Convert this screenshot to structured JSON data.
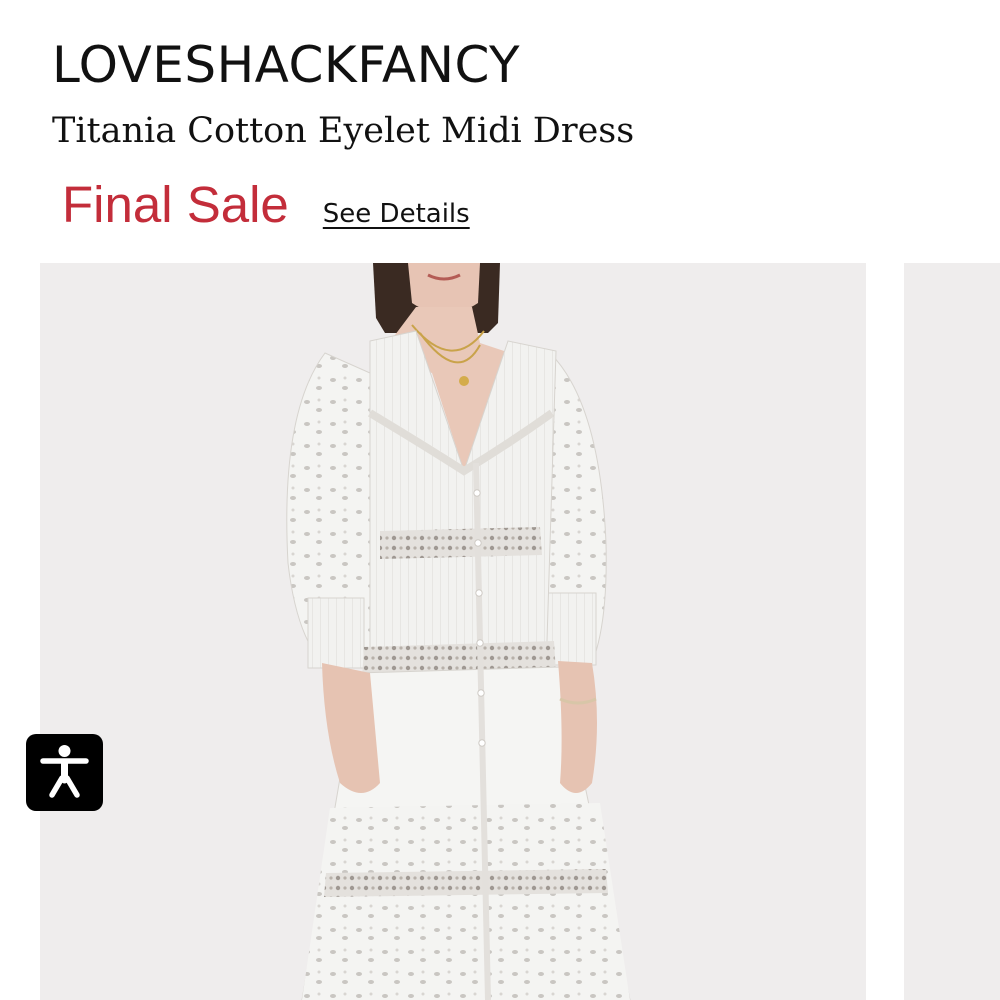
{
  "product": {
    "brand": "LOVESHACKFANCY",
    "name": "Titania Cotton Eyelet Midi Dress",
    "sale_label": "Final Sale",
    "details_link": "See Details"
  },
  "gallery": {
    "images": [
      {
        "subject": "model wearing white eyelet midi dress"
      },
      {
        "subject": "next product image (partially visible)"
      }
    ]
  },
  "accessibility": {
    "icon": "accessibility-person-icon"
  },
  "colors": {
    "sale": "#c32d3a",
    "text": "#111111",
    "image_background": "#efeded",
    "accessibility_button": "#000000"
  }
}
